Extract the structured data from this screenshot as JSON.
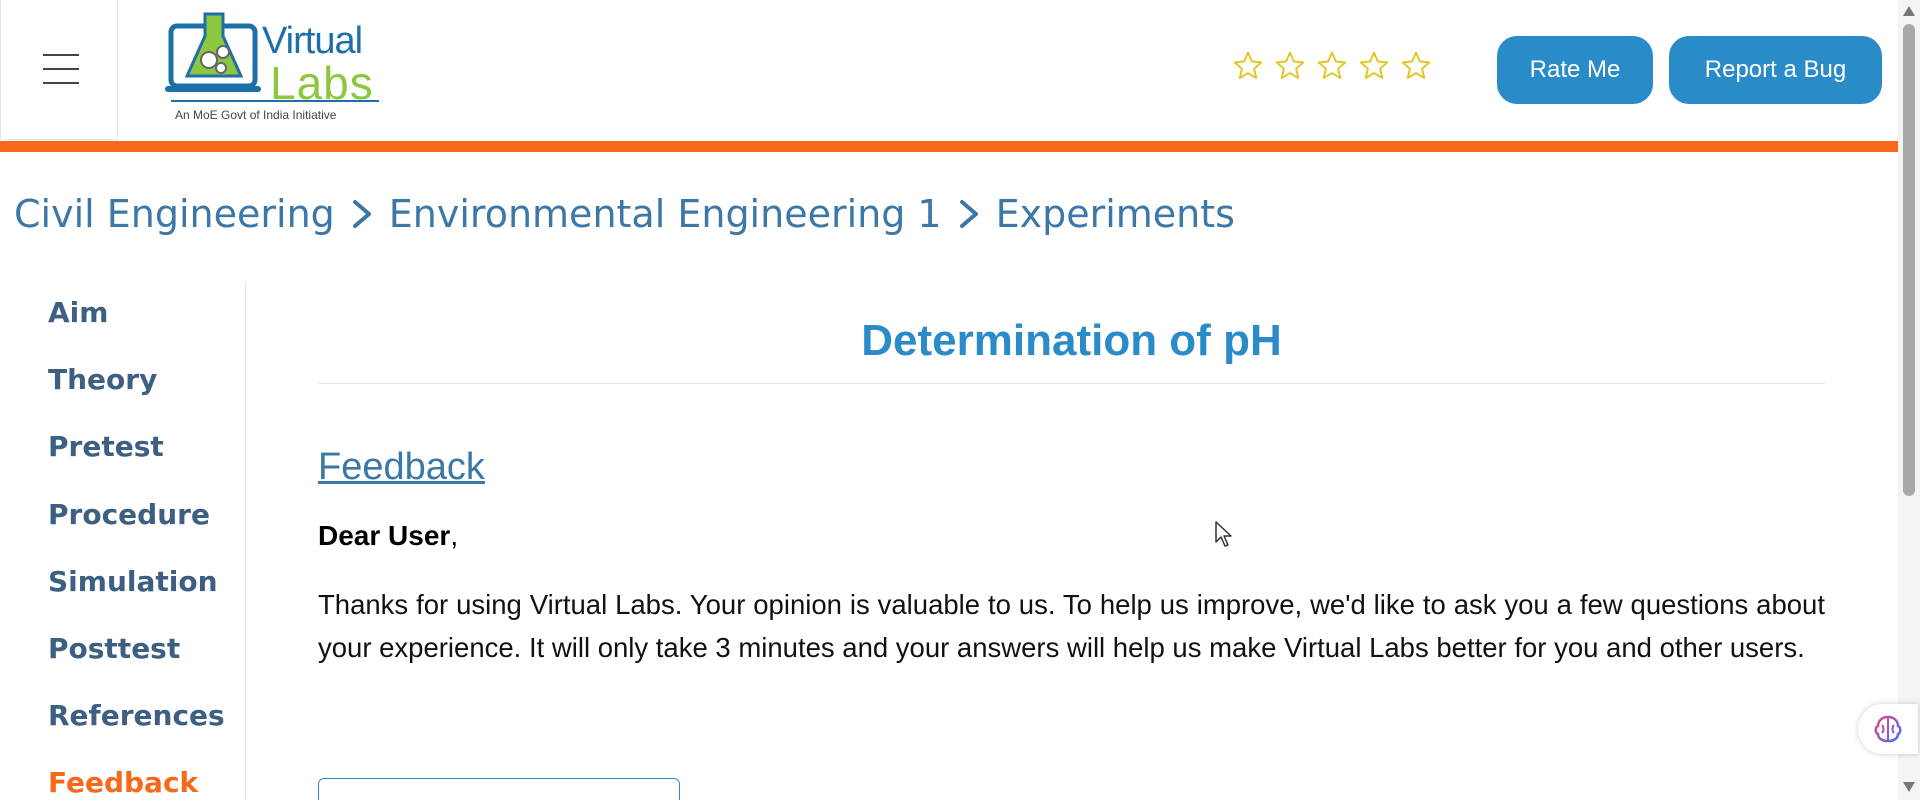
{
  "header": {
    "logo": {
      "title_line1": "Virtual",
      "title_line2": "Labs",
      "tagline": "An MoE Govt of India Initiative"
    },
    "rating": {
      "stars_total": 5,
      "stars_filled": 0,
      "star_color": "#e6c31a"
    },
    "rate_button": "Rate Me",
    "report_button": "Report a Bug",
    "accent_color": "#f6691a",
    "button_color": "#2a8bc9"
  },
  "breadcrumb": {
    "items": [
      "Civil Engineering",
      "Environmental Engineering 1",
      "Experiments"
    ],
    "separator_icon": "chevron-right-icon"
  },
  "sidebar": {
    "items": [
      {
        "label": "Aim",
        "active": false
      },
      {
        "label": "Theory",
        "active": false
      },
      {
        "label": "Pretest",
        "active": false
      },
      {
        "label": "Procedure",
        "active": false
      },
      {
        "label": "Simulation",
        "active": false
      },
      {
        "label": "Posttest",
        "active": false
      },
      {
        "label": "References",
        "active": false
      },
      {
        "label": "Feedback",
        "active": true
      }
    ]
  },
  "main": {
    "title": "Determination of pH",
    "section_heading": "Feedback",
    "greeting_name": "Dear User",
    "greeting_suffix": ",",
    "paragraph": "Thanks for using Virtual Labs. Your opinion is valuable to us. To help us improve, we'd like to ask you a few questions about your experience. It will only take 3 minutes and your answers will help us make Virtual Labs better for you and other users."
  },
  "widgets": {
    "floating_icon": "brain-icon"
  }
}
